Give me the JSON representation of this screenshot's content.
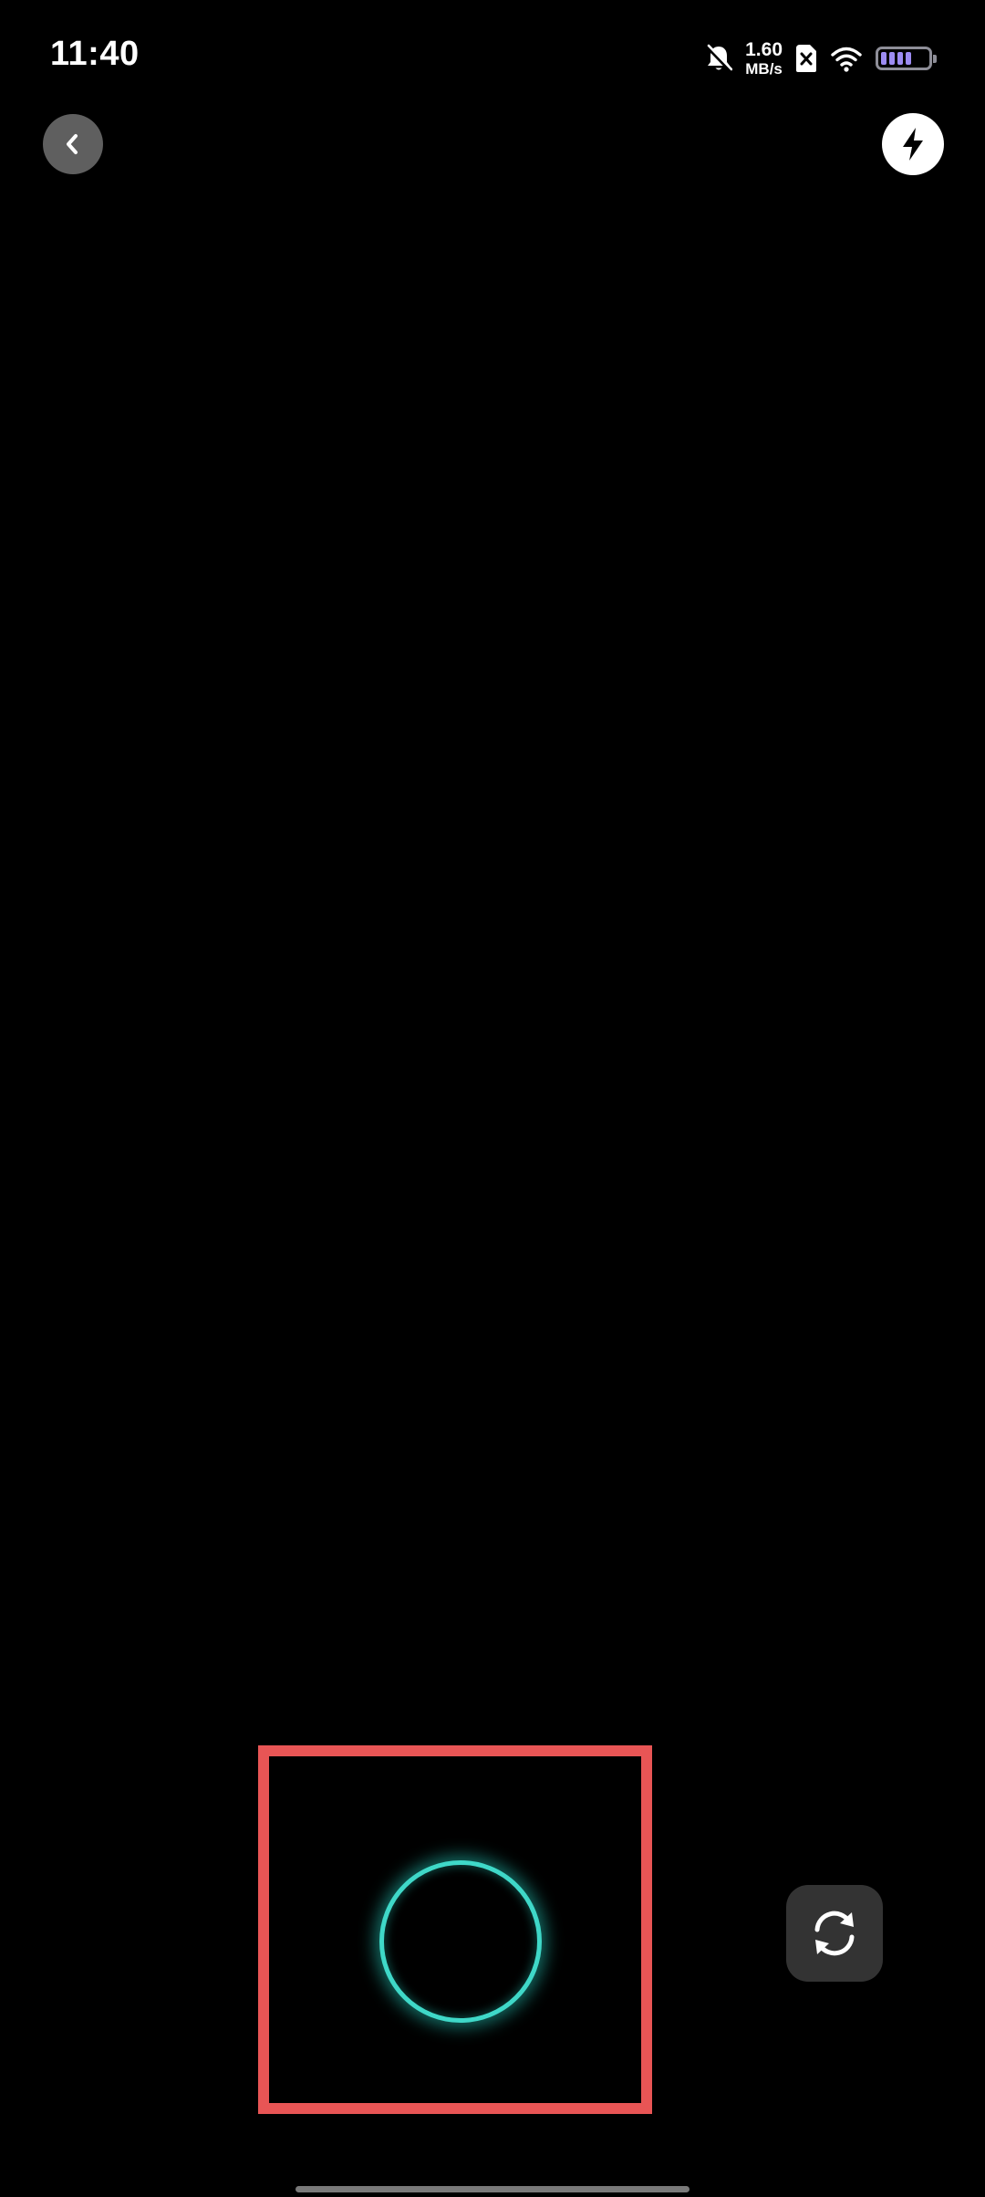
{
  "status_bar": {
    "time": "11:40",
    "net_speed_value": "1.60",
    "net_speed_unit": "MB/s",
    "icons": [
      "bell-off-icon",
      "sim-off-icon",
      "wifi-icon",
      "battery-icon"
    ],
    "battery_color": "#9d8cf2"
  },
  "toolbar": {
    "back_icon": "chevron-left-icon",
    "flash_icon": "flash-icon"
  },
  "camera_controls": {
    "shutter_icon": "shutter-ring",
    "shutter_ring_color": "#3fd8c8",
    "highlight_color": "#e85555",
    "switch_camera_icon": "camera-switch-icon"
  }
}
